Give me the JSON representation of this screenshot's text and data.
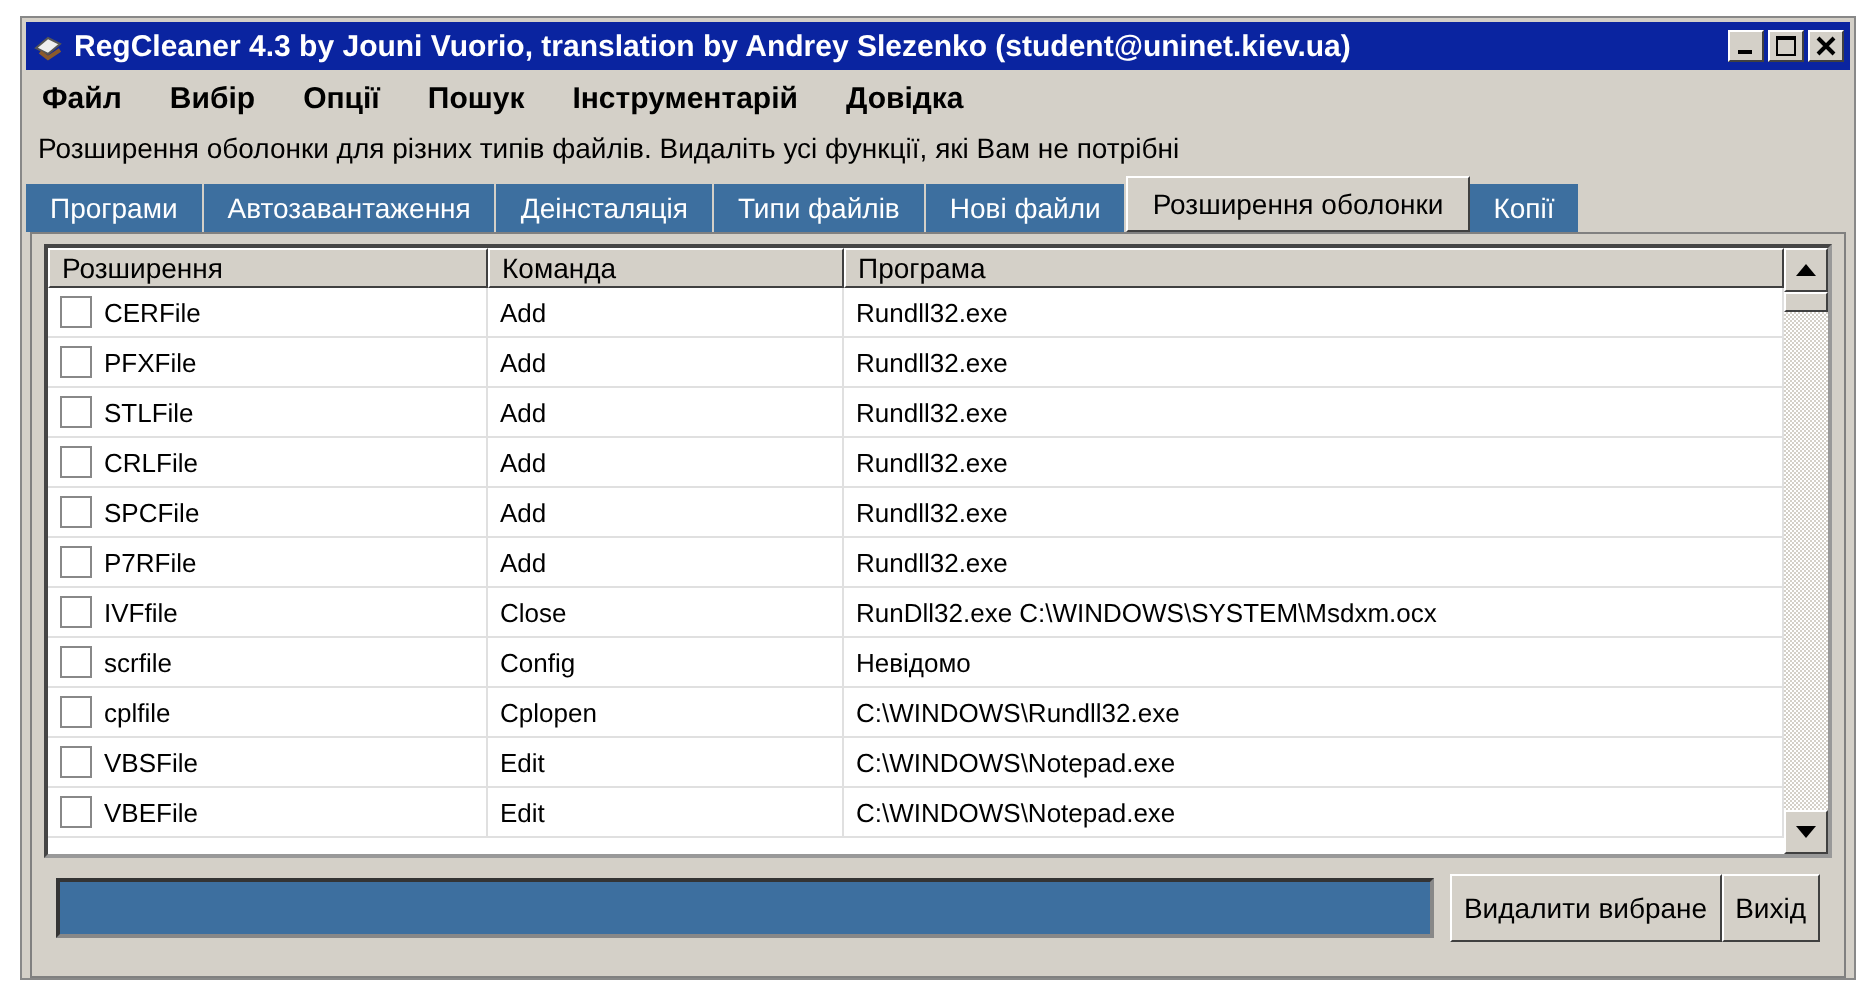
{
  "window": {
    "title": "RegCleaner 4.3 by Jouni Vuorio, translation by Andrey Slezenko (student@uninet.kiev.ua)"
  },
  "menu": [
    "Файл",
    "Вибір",
    "Опції",
    "Пошук",
    "Інструментарій",
    "Довідка"
  ],
  "description": "Розширення оболонки для різних типів файлів. Видаліть усі функції, які Вам не потрібні",
  "tabs": [
    {
      "label": "Програми",
      "selected": false
    },
    {
      "label": "Автозавантаження",
      "selected": false
    },
    {
      "label": "Деінсталяція",
      "selected": false
    },
    {
      "label": "Типи файлів",
      "selected": false
    },
    {
      "label": "Нові файли",
      "selected": false
    },
    {
      "label": "Розширення оболонки",
      "selected": true
    },
    {
      "label": "Копії",
      "selected": false
    }
  ],
  "table": {
    "columns": [
      "Розширення",
      "Команда",
      "Програма"
    ],
    "rows": [
      {
        "checked": false,
        "cells": [
          "CERFile",
          "Add",
          "Rundll32.exe"
        ]
      },
      {
        "checked": false,
        "cells": [
          "PFXFile",
          "Add",
          "Rundll32.exe"
        ]
      },
      {
        "checked": false,
        "cells": [
          "STLFile",
          "Add",
          "Rundll32.exe"
        ]
      },
      {
        "checked": false,
        "cells": [
          "CRLFile",
          "Add",
          "Rundll32.exe"
        ]
      },
      {
        "checked": false,
        "cells": [
          "SPCFile",
          "Add",
          "Rundll32.exe"
        ]
      },
      {
        "checked": false,
        "cells": [
          "P7RFile",
          "Add",
          "Rundll32.exe"
        ]
      },
      {
        "checked": false,
        "cells": [
          "IVFfile",
          "Close",
          "RunDll32.exe C:\\WINDOWS\\SYSTEM\\Msdxm.ocx"
        ]
      },
      {
        "checked": false,
        "cells": [
          "scrfile",
          "Config",
          "Невідомо"
        ]
      },
      {
        "checked": false,
        "cells": [
          "cplfile",
          "Cplopen",
          "C:\\WINDOWS\\Rundll32.exe"
        ]
      },
      {
        "checked": false,
        "cells": [
          "VBSFile",
          "Edit",
          "C:\\WINDOWS\\Notepad.exe"
        ]
      },
      {
        "checked": false,
        "cells": [
          "VBEFile",
          "Edit",
          "C:\\WINDOWS\\Notepad.exe"
        ]
      }
    ]
  },
  "buttons": [
    "Видалити вибране",
    "Вихід"
  ]
}
